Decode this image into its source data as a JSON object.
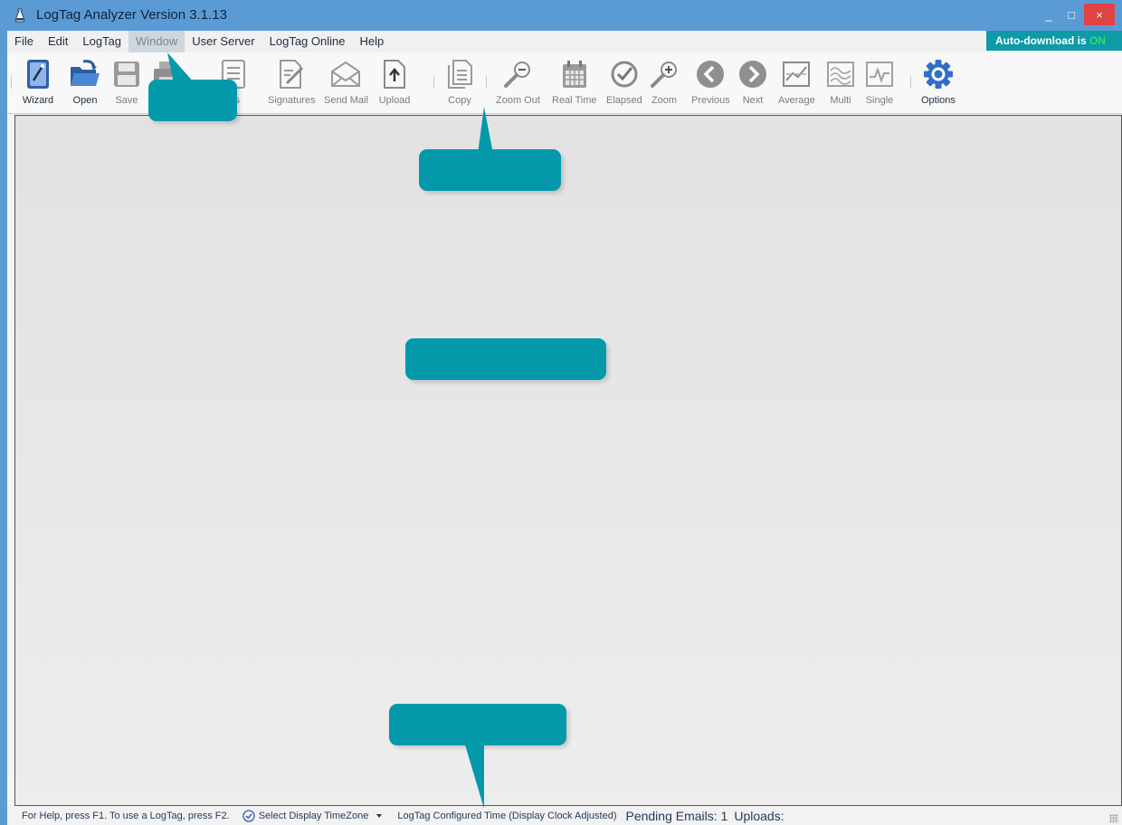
{
  "window": {
    "title": "LogTag Analyzer  Version 3.1.13",
    "controls": {
      "minimize": "_",
      "maximize": "□",
      "close": "×"
    }
  },
  "menu": {
    "items": [
      {
        "label": "File"
      },
      {
        "label": "Edit"
      },
      {
        "label": "LogTag"
      },
      {
        "label": "Window",
        "state": "highlighted"
      },
      {
        "label": "User Server"
      },
      {
        "label": "LogTag Online"
      },
      {
        "label": "Help"
      }
    ]
  },
  "auto_download": {
    "prefix": "Auto-download is ",
    "state": "ON"
  },
  "toolbar": {
    "buttons": [
      {
        "label": "Wizard",
        "icon": "wizard-icon"
      },
      {
        "label": "Open",
        "icon": "open-folder-icon"
      },
      {
        "label": "Save",
        "icon": "save-disk-icon"
      },
      {
        "label": "",
        "icon": "print-icon"
      },
      {
        "label": "ies",
        "icon": "properties-list-icon"
      },
      {
        "label": "Signatures",
        "icon": "signature-icon"
      },
      {
        "label": "Send Mail",
        "icon": "mail-envelope-icon"
      },
      {
        "label": "Upload",
        "icon": "upload-icon"
      },
      {
        "label": "Copy",
        "icon": "copy-document-icon"
      },
      {
        "label": "Zoom Out",
        "icon": "zoom-out-icon"
      },
      {
        "label": "Real Time",
        "icon": "calendar-icon"
      },
      {
        "label": "Elapsed",
        "icon": "elapsed-clock-icon"
      },
      {
        "label": "Zoom",
        "icon": "zoom-in-icon"
      },
      {
        "label": "Previous",
        "icon": "previous-arrow-icon"
      },
      {
        "label": "Next",
        "icon": "next-arrow-icon"
      },
      {
        "label": "Average",
        "icon": "average-chart-icon"
      },
      {
        "label": "Multi",
        "icon": "multi-chart-icon"
      },
      {
        "label": "Single",
        "icon": "single-chart-icon"
      },
      {
        "label": "Options",
        "icon": "options-gear-icon"
      }
    ]
  },
  "status": {
    "help": "For Help, press F1. To use a LogTag, press F2.",
    "timezone": "Select Display TimeZone",
    "time_mode": "LogTag Configured Time (Display Clock Adjusted)",
    "pending": "Pending Emails: 1",
    "uploads": "Uploads:"
  },
  "colors": {
    "titlebar": "#5b9bd5",
    "callout": "#0399ab",
    "close": "#e04343",
    "on_indicator": "#2ee05c"
  }
}
